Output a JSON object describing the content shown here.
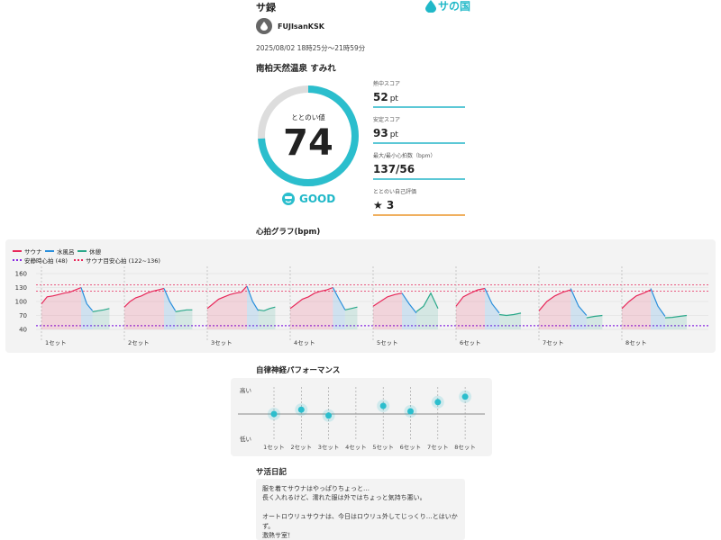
{
  "header": {
    "title": "サ録",
    "logo_text": "サの国",
    "username": "FUJIsanKSK",
    "datetime": "2025/08/02 18時25分～21時59分",
    "facility": "南柏天然温泉 すみれ"
  },
  "gauge": {
    "label": "ととのい値",
    "value": "74",
    "max": 100,
    "status": "GOOD",
    "color": "#2bbecd"
  },
  "scores": [
    {
      "label": "熱中スコア",
      "value": "52",
      "unit": "pt"
    },
    {
      "label": "安定スコア",
      "value": "93",
      "unit": "pt"
    },
    {
      "label": "最大/最小心拍数（bpm）",
      "value": "137/56",
      "unit": ""
    },
    {
      "label": "ととのい自己評価",
      "value": "★ 3",
      "unit": ""
    }
  ],
  "heart_chart": {
    "section_title": "心拍グラフ(bpm)",
    "legend": [
      {
        "name": "サウナ",
        "color": "#e8285a"
      },
      {
        "name": "水風呂",
        "color": "#2a8fdc"
      },
      {
        "name": "休憩",
        "color": "#2aa88a"
      },
      {
        "name": "安静時心拍 (48)",
        "color": "#8a2be2"
      },
      {
        "name": "サウナ目安心拍 (122~136)",
        "color": "#e8285a"
      }
    ],
    "y_ticks": [
      "160",
      "130",
      "100",
      "70",
      "40"
    ],
    "set_labels": [
      "1セット",
      "2セット",
      "3セット",
      "4セット",
      "5セット",
      "6セット",
      "7セット",
      "8セット"
    ]
  },
  "chart_data": {
    "type": "line",
    "title": "心拍グラフ(bpm)",
    "ylim": [
      40,
      160
    ],
    "resting_hr": 48,
    "sauna_target_range": [
      122,
      136
    ],
    "sets": [
      {
        "name": "1セット",
        "sauna": [
          95,
          110,
          112,
          115,
          118,
          120,
          125,
          130
        ],
        "cold": [
          130,
          95,
          80
        ],
        "rest": [
          78,
          80,
          82,
          85
        ]
      },
      {
        "name": "2セット",
        "sauna": [
          88,
          100,
          108,
          112,
          118,
          122,
          125,
          128
        ],
        "cold": [
          128,
          100,
          80
        ],
        "rest": [
          78,
          80,
          82,
          82
        ]
      },
      {
        "name": "3セット",
        "sauna": [
          85,
          95,
          105,
          110,
          115,
          118,
          120,
          133
        ],
        "cold": [
          133,
          100,
          80
        ],
        "rest": [
          82,
          80,
          85,
          88
        ]
      },
      {
        "name": "4セット",
        "sauna": [
          85,
          95,
          105,
          110,
          118,
          122,
          125,
          130
        ],
        "cold": [
          130,
          105,
          82
        ],
        "rest": [
          82,
          85,
          88
        ]
      },
      {
        "name": "5セット",
        "sauna": [
          90,
          100,
          110,
          115,
          118
        ],
        "cold": [
          118,
          95,
          75
        ],
        "rest": [
          78,
          90,
          118,
          85
        ]
      },
      {
        "name": "6セット",
        "sauna": [
          90,
          110,
          118,
          125,
          128
        ],
        "cold": [
          128,
          95,
          75
        ],
        "rest": [
          72,
          70,
          72,
          75
        ]
      },
      {
        "name": "7セット",
        "sauna": [
          80,
          100,
          112,
          120,
          125
        ],
        "cold": [
          128,
          90,
          70
        ],
        "rest": [
          65,
          68,
          70
        ]
      },
      {
        "name": "8セット",
        "sauna": [
          85,
          100,
          112,
          118,
          125
        ],
        "cold": [
          128,
          90,
          68
        ],
        "rest": [
          65,
          66,
          68,
          70
        ]
      }
    ]
  },
  "autonomic": {
    "section_title": "自律神経パフォーマンス",
    "y_high": "高い",
    "y_low": "低い",
    "labels": [
      "1セット",
      "2セット",
      "3セット",
      "4セット",
      "5セット",
      "6セット",
      "7セット",
      "8セット"
    ],
    "values": [
      0.0,
      0.08,
      -0.03,
      null,
      0.15,
      0.05,
      0.22,
      0.32
    ],
    "color": "#2bbecd"
  },
  "diary": {
    "section_title": "サ活日記",
    "text": "服を着てサウナはやっぱりちょっと…\n長く入れるけど、濡れた服は外ではちょっと気持ち悪い。\n\nオートロウリュサウナは、今日はロウリュ外してじっくり…とはいかず。\n激熱サ室！\nさすが「すみれ」。"
  }
}
